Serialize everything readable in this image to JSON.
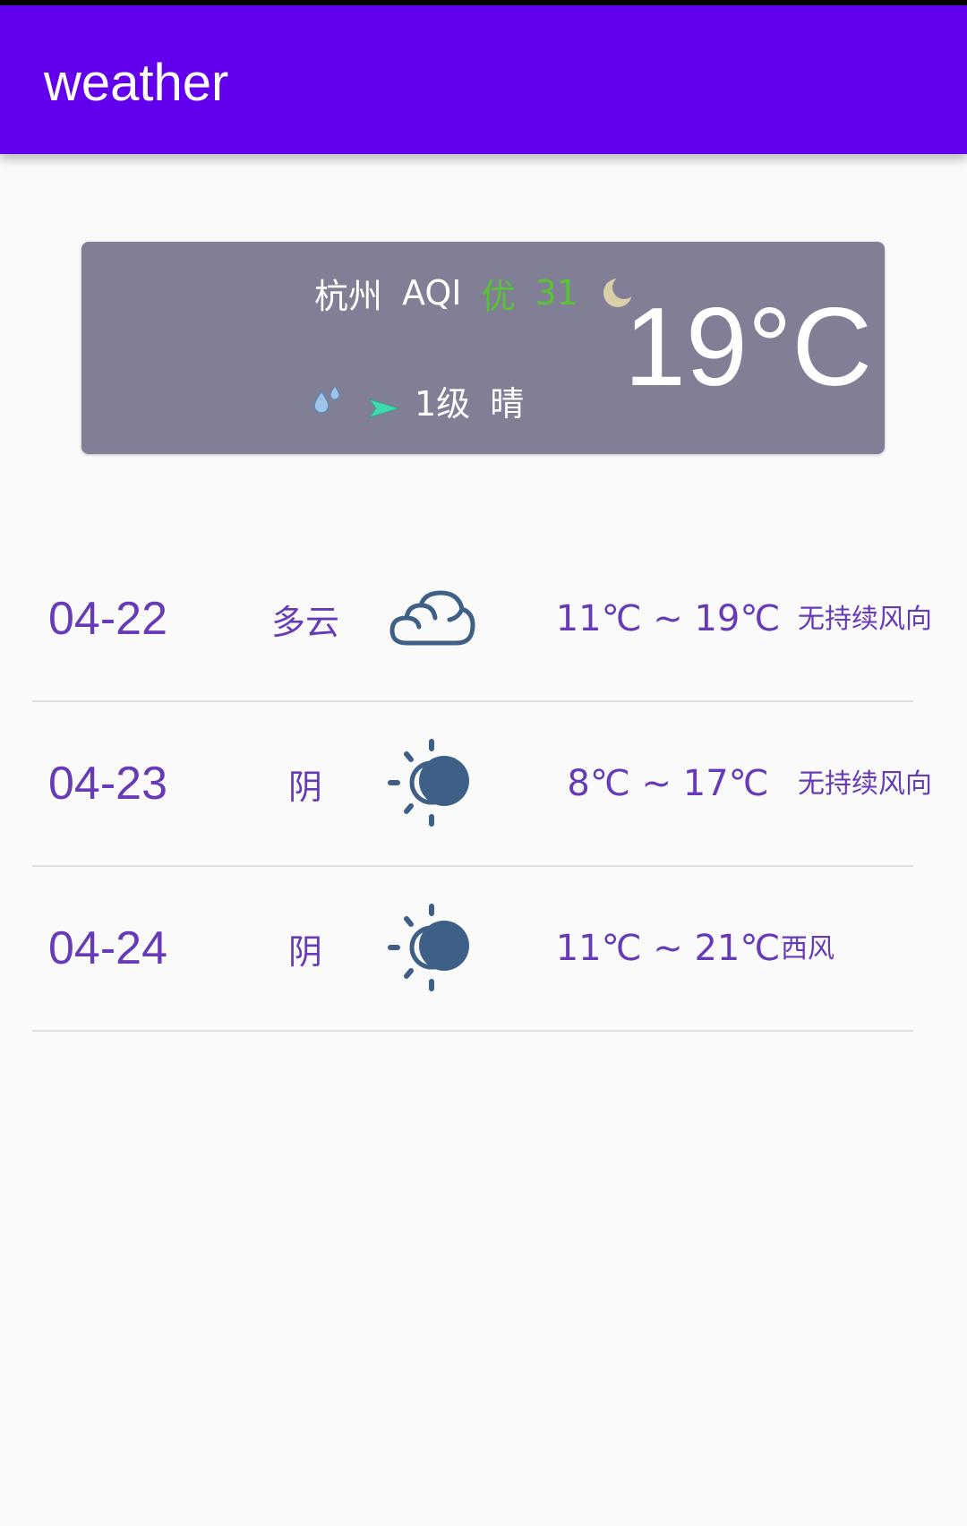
{
  "app": {
    "title": "weather"
  },
  "current": {
    "city": "杭州",
    "aqi_label": "AQI",
    "aqi_level": "优",
    "aqi_value": "31",
    "wind_level": "1级",
    "condition": "晴",
    "temperature": "19°C",
    "icons": {
      "time_of_day": "moon-icon",
      "humidity": "water-drop-icon",
      "wind": "wind-direction-arrow-icon"
    }
  },
  "forecast": [
    {
      "date": "04-22",
      "condition": "多云",
      "icon": "cloudy-icon",
      "temp_range": "11℃ ~ 19℃",
      "wind": "无持续风向"
    },
    {
      "date": "04-23",
      "condition": "阴",
      "icon": "sun-behind-cloud-icon",
      "temp_range": "8℃ ~ 17℃",
      "wind": "无持续风向"
    },
    {
      "date": "04-24",
      "condition": "阴",
      "icon": "sun-behind-cloud-icon",
      "temp_range": "11℃ ~ 21℃",
      "wind": "西风"
    }
  ],
  "colors": {
    "app_bar": "#6200ee",
    "card_bg": "#817f96",
    "aqi_good": "#5bc236",
    "list_text": "#673ab7",
    "icon_fill": "#3e5f86"
  }
}
